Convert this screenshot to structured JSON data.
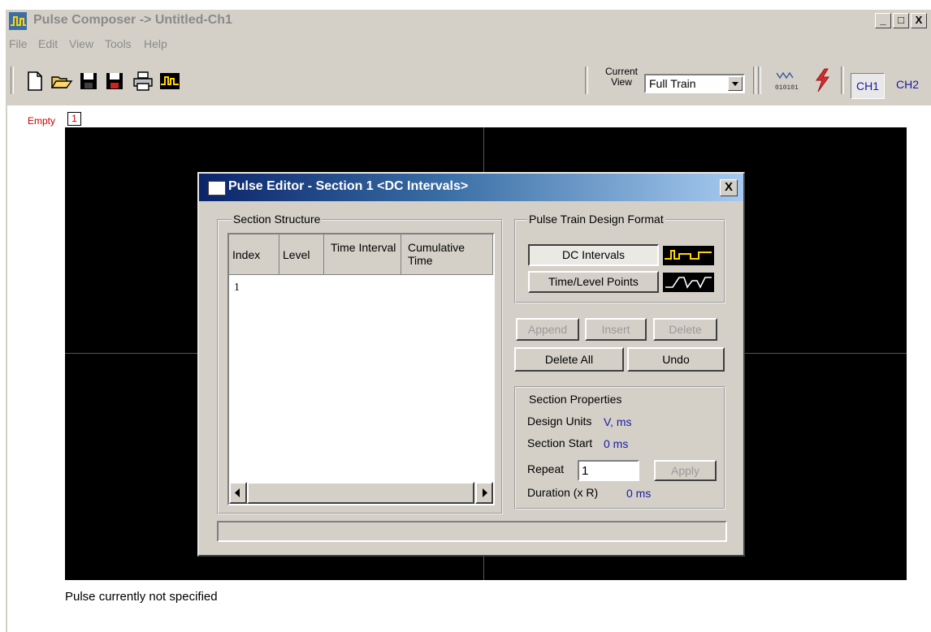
{
  "app": {
    "title": "Pulse Composer -> Untitled-Ch1",
    "window_buttons": [
      "_",
      "□",
      "X"
    ]
  },
  "menu": [
    "File",
    "Edit",
    "View",
    "Tools",
    "Help"
  ],
  "toolbar": {
    "icons": [
      "new-file-icon",
      "open-folder-icon",
      "save-icon",
      "save-as-icon",
      "print-icon",
      "pulse-wave-icon"
    ],
    "current_view_label": "Current View",
    "current_view_value": "Full Train",
    "channels": [
      "CH1",
      "CH2"
    ]
  },
  "workspace": {
    "section_status": "Empty",
    "section_number": "1",
    "status_text": "Pulse currently not specified"
  },
  "dialog": {
    "title": "Pulse Editor - Section 1   <DC Intervals>",
    "close_label": "X",
    "section_structure": {
      "label": "Section Structure",
      "columns": [
        "Index",
        "Level",
        "Time Interval",
        "Cumulative Time"
      ],
      "rows": [
        [
          "1",
          "",
          "",
          ""
        ]
      ]
    },
    "design_format": {
      "label": "Pulse Train Design Format",
      "options": [
        "DC Intervals",
        "Time/Level Points"
      ],
      "selected": "DC Intervals"
    },
    "buttons": {
      "append": "Append",
      "insert": "Insert",
      "delete": "Delete",
      "delete_all": "Delete All",
      "undo": "Undo"
    },
    "section_properties": {
      "label": "Section Properties",
      "design_units_label": "Design Units",
      "design_units_value": "V, ms",
      "section_start_label": "Section Start",
      "section_start_value": "0 ms",
      "repeat_label": "Repeat",
      "repeat_value": "1",
      "apply_label": "Apply",
      "duration_label": "Duration (x R)",
      "duration_value": "0 ms"
    }
  }
}
